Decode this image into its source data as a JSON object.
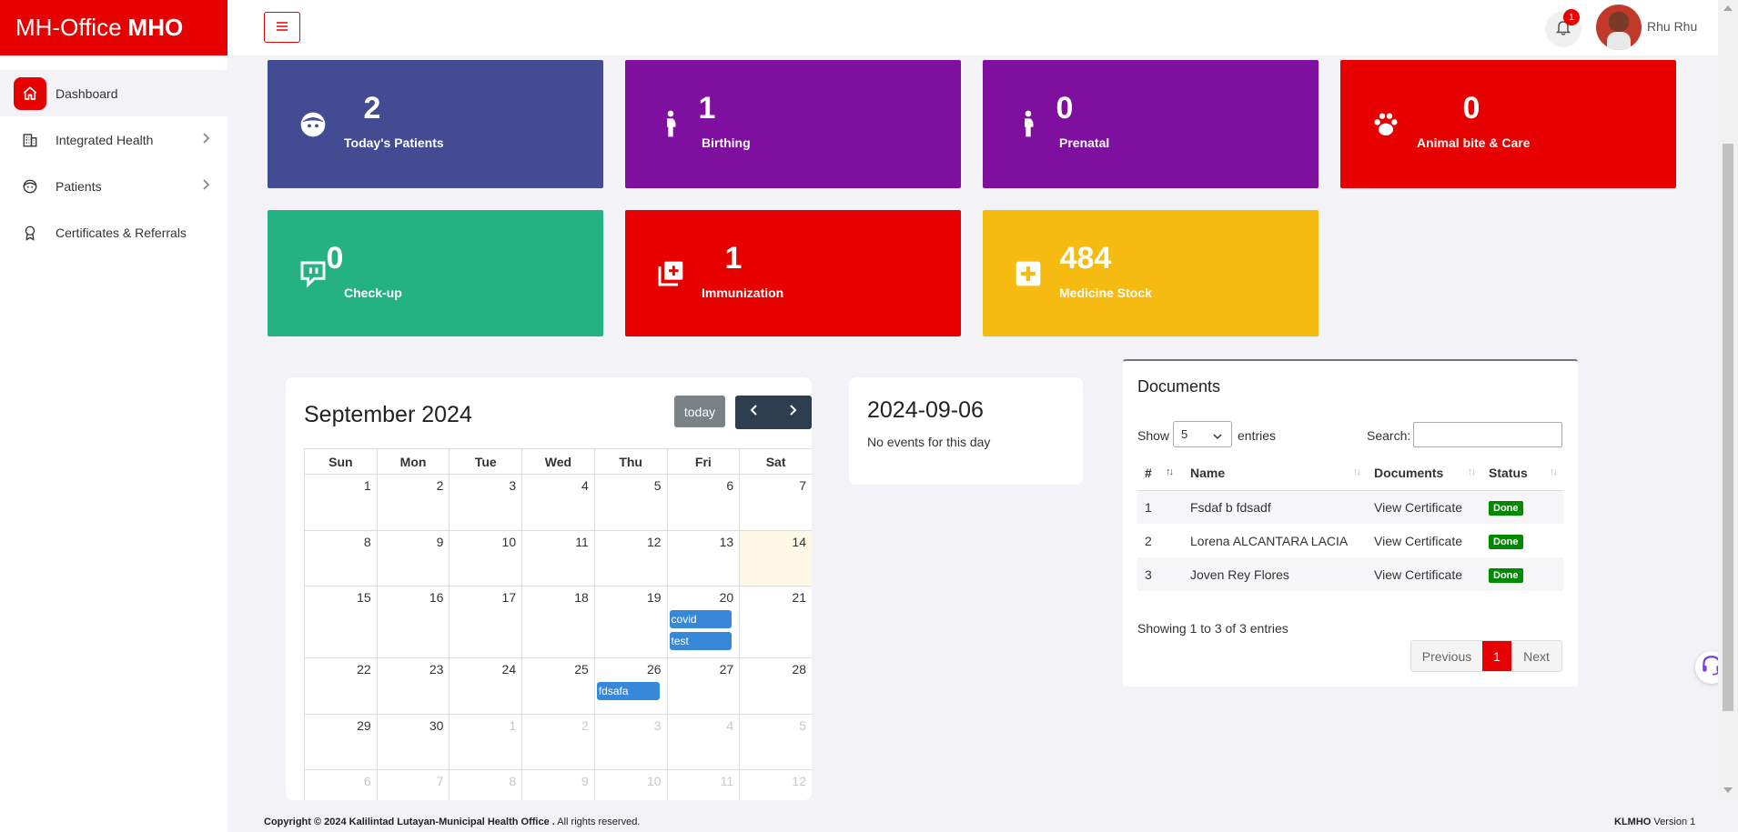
{
  "brand": {
    "name": "MH-Office",
    "suffix": "MHO"
  },
  "colors": {
    "brand": "#e60000",
    "sidebar_bg": "#ffffff",
    "content_bg": "#f2f2f7"
  },
  "sidebar": {
    "items": [
      {
        "label": "Dashboard",
        "icon": "home-icon",
        "active": true
      },
      {
        "label": "Integrated Health",
        "icon": "building-icon",
        "has_submenu": true
      },
      {
        "label": "Patients",
        "icon": "face-icon",
        "has_submenu": true
      },
      {
        "label": "Certificates & Referrals",
        "icon": "award-icon"
      }
    ]
  },
  "topbar": {
    "menu_icon": "hamburger-icon",
    "notification_count": "1",
    "user_name": "Rhu Rhu"
  },
  "cards": [
    {
      "value": "2",
      "label": "Today's Patients",
      "color": "#434b93",
      "icon": "face-icon"
    },
    {
      "value": "1",
      "label": "Birthing",
      "color": "#7e0f9f",
      "icon": "pregnant-icon"
    },
    {
      "value": "0",
      "label": "Prenatal",
      "color": "#7e0f9f",
      "icon": "pregnant-icon"
    },
    {
      "value": "0",
      "label": "Animal bite & Care",
      "color": "#e60000",
      "icon": "paw-icon"
    },
    {
      "value": "0",
      "label": "Check-up",
      "color": "#24b282",
      "icon": "chat-icon"
    },
    {
      "value": "1",
      "label": "Immunization",
      "color": "#e60000",
      "icon": "add-layers-icon"
    },
    {
      "value": "484",
      "label": "Medicine Stock",
      "color": "#f6bb10",
      "icon": "plus-square-icon"
    }
  ],
  "calendar": {
    "title": "September 2024",
    "today_label": "today",
    "weekdays": [
      "Sun",
      "Mon",
      "Tue",
      "Wed",
      "Thu",
      "Fri",
      "Sat"
    ],
    "weeks": [
      [
        "1",
        "2",
        "3",
        "4",
        "5",
        "6",
        "7"
      ],
      [
        "8",
        "9",
        "10",
        "11",
        "12",
        "13",
        "14"
      ],
      [
        "15",
        "16",
        "17",
        "18",
        "19",
        "20",
        "21"
      ],
      [
        "22",
        "23",
        "24",
        "25",
        "26",
        "27",
        "28"
      ],
      [
        "29",
        "30",
        "1",
        "2",
        "3",
        "4",
        "5"
      ],
      [
        "6",
        "7",
        "8",
        "9",
        "10",
        "11",
        "12"
      ]
    ],
    "events": {
      "covid": "covid",
      "test": "test",
      "fdsafa": "fdsafa"
    }
  },
  "day_panel": {
    "date": "2024-09-06",
    "message": "No events for this day"
  },
  "documents": {
    "title": "Documents",
    "show_label": "Show",
    "page_size": "5",
    "entries_label": "entries",
    "search_label": "Search:",
    "columns": [
      "#",
      "Name",
      "Documents",
      "Status"
    ],
    "rows": [
      {
        "num": "1",
        "name": "Fsdaf b fdsadf",
        "doc": "View Certificate",
        "status": "Done"
      },
      {
        "num": "2",
        "name": "Lorena ALCANTARA LACIA",
        "doc": "View Certificate",
        "status": "Done"
      },
      {
        "num": "3",
        "name": "Joven Rey Flores",
        "doc": "View Certificate",
        "status": "Done"
      }
    ],
    "info": "Showing 1 to 3 of 3 entries",
    "pager": {
      "previous": "Previous",
      "current": "1",
      "next": "Next"
    }
  },
  "footer": {
    "copyright_prefix": "Copyright © 2024 Kalilintad Lutayan-Municipal Health Office .",
    "copyright_suffix": " All rights reserved.",
    "version_brand": "KLMHO",
    "version_text": " Version 1"
  }
}
